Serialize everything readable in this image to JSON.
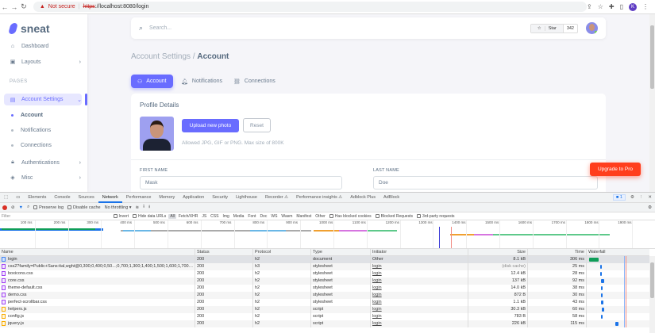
{
  "browser": {
    "security_label": "Not secure",
    "url_scheme": "https",
    "url_rest": "://localhost:8080/login",
    "profile_initial": "K"
  },
  "app": {
    "brand": "sneat",
    "sidebar": {
      "items": [
        {
          "label": "Dashboard",
          "icon": "home-icon"
        },
        {
          "label": "Layouts",
          "icon": "layout-icon"
        }
      ],
      "section_header": "PAGES",
      "account_settings": "Account Settings",
      "subitems": [
        "Account",
        "Notifications",
        "Connections"
      ],
      "more_items": [
        {
          "label": "Authentications",
          "icon": "lock-icon"
        },
        {
          "label": "Misc",
          "icon": "cube-icon"
        }
      ]
    },
    "navbar": {
      "search_placeholder": "Search...",
      "star_label": "Star",
      "star_count": "342"
    },
    "breadcrumb": {
      "parent": "Account Settings /",
      "current": "Account"
    },
    "tabs": [
      "Account",
      "Notifications",
      "Connections"
    ],
    "profile": {
      "title": "Profile Details",
      "upload_label": "Upload new photo",
      "reset_label": "Reset",
      "hint": "Allowed JPG, GIF or PNG. Max size of 800K",
      "first_name_label": "FIRST NAME",
      "first_name_value": "Mask",
      "last_name_label": "LAST NAME",
      "last_name_value": "Doe"
    },
    "upgrade_label": "Upgrade to Pro",
    "accent": "#696cff"
  },
  "devtools": {
    "tabs": [
      "Elements",
      "Console",
      "Sources",
      "Network",
      "Performance",
      "Memory",
      "Application",
      "Security",
      "Lighthouse",
      "Recorder ⚠",
      "Performance insights ⚠",
      "Adblock Plus",
      "AdBlock"
    ],
    "active_tab": "Network",
    "issues_count": "1",
    "toolbar": {
      "preserve_log": "Preserve log",
      "disable_cache": "Disable cache",
      "throttling": "No throttling"
    },
    "filter": {
      "placeholder": "Filter",
      "invert": "Invert",
      "hide_data_urls": "Hide data URLs",
      "types": [
        "All",
        "Fetch/XHR",
        "JS",
        "CSS",
        "Img",
        "Media",
        "Font",
        "Doc",
        "WS",
        "Wasm",
        "Manifest",
        "Other"
      ],
      "has_blocked_cookies": "Has blocked cookies",
      "blocked_requests": "Blocked Requests",
      "third_party": "3rd-party requests"
    },
    "timeline_ticks": [
      "100 ms",
      "200 ms",
      "300 ms",
      "400 ms",
      "500 ms",
      "600 ms",
      "700 ms",
      "800 ms",
      "900 ms",
      "1000 ms",
      "1100 ms",
      "1200 ms",
      "1300 ms",
      "1400 ms",
      "1500 ms",
      "1600 ms",
      "1700 ms",
      "1800 ms",
      "1900 ms"
    ],
    "columns": [
      "Name",
      "Status",
      "Protocol",
      "Type",
      "Initiator",
      "Size",
      "Time",
      "Waterfall"
    ],
    "rows": [
      {
        "name": "login",
        "status": "200",
        "protocol": "h2",
        "type": "document",
        "initiator": "Other",
        "size": "8.1 kB",
        "time": "306 ms",
        "kind": "doc"
      },
      {
        "name": "css2?family=Public+Sans:ital,wght@0,300;0,400;0,50...;0,700;1,300;1,400;1,500;1,600;1,700&display=s...",
        "status": "200",
        "protocol": "h3",
        "type": "stylesheet",
        "initiator": "login",
        "size": "(disk cache)",
        "time": "25 ms",
        "kind": "css"
      },
      {
        "name": "boxicons.css",
        "status": "200",
        "protocol": "h2",
        "type": "stylesheet",
        "initiator": "login",
        "size": "12.4 kB",
        "time": "28 ms",
        "kind": "css"
      },
      {
        "name": "core.css",
        "status": "200",
        "protocol": "h2",
        "type": "stylesheet",
        "initiator": "login",
        "size": "137 kB",
        "time": "92 ms",
        "kind": "css"
      },
      {
        "name": "theme-default.css",
        "status": "200",
        "protocol": "h2",
        "type": "stylesheet",
        "initiator": "login",
        "size": "14.0 kB",
        "time": "38 ms",
        "kind": "css"
      },
      {
        "name": "demo.css",
        "status": "200",
        "protocol": "h2",
        "type": "stylesheet",
        "initiator": "login",
        "size": "872 B",
        "time": "30 ms",
        "kind": "css"
      },
      {
        "name": "perfect-scrollbar.css",
        "status": "200",
        "protocol": "h2",
        "type": "stylesheet",
        "initiator": "login",
        "size": "1.1 kB",
        "time": "43 ms",
        "kind": "css"
      },
      {
        "name": "helpers.js",
        "status": "200",
        "protocol": "h2",
        "type": "script",
        "initiator": "login",
        "size": "30.3 kB",
        "time": "60 ms",
        "kind": "js"
      },
      {
        "name": "config.js",
        "status": "200",
        "protocol": "h2",
        "type": "script",
        "initiator": "login",
        "size": "783 B",
        "time": "58 ms",
        "kind": "js"
      },
      {
        "name": "jquery.js",
        "status": "200",
        "protocol": "h2",
        "type": "script",
        "initiator": "login",
        "size": "226 kB",
        "time": "115 ms",
        "kind": "js"
      }
    ]
  }
}
